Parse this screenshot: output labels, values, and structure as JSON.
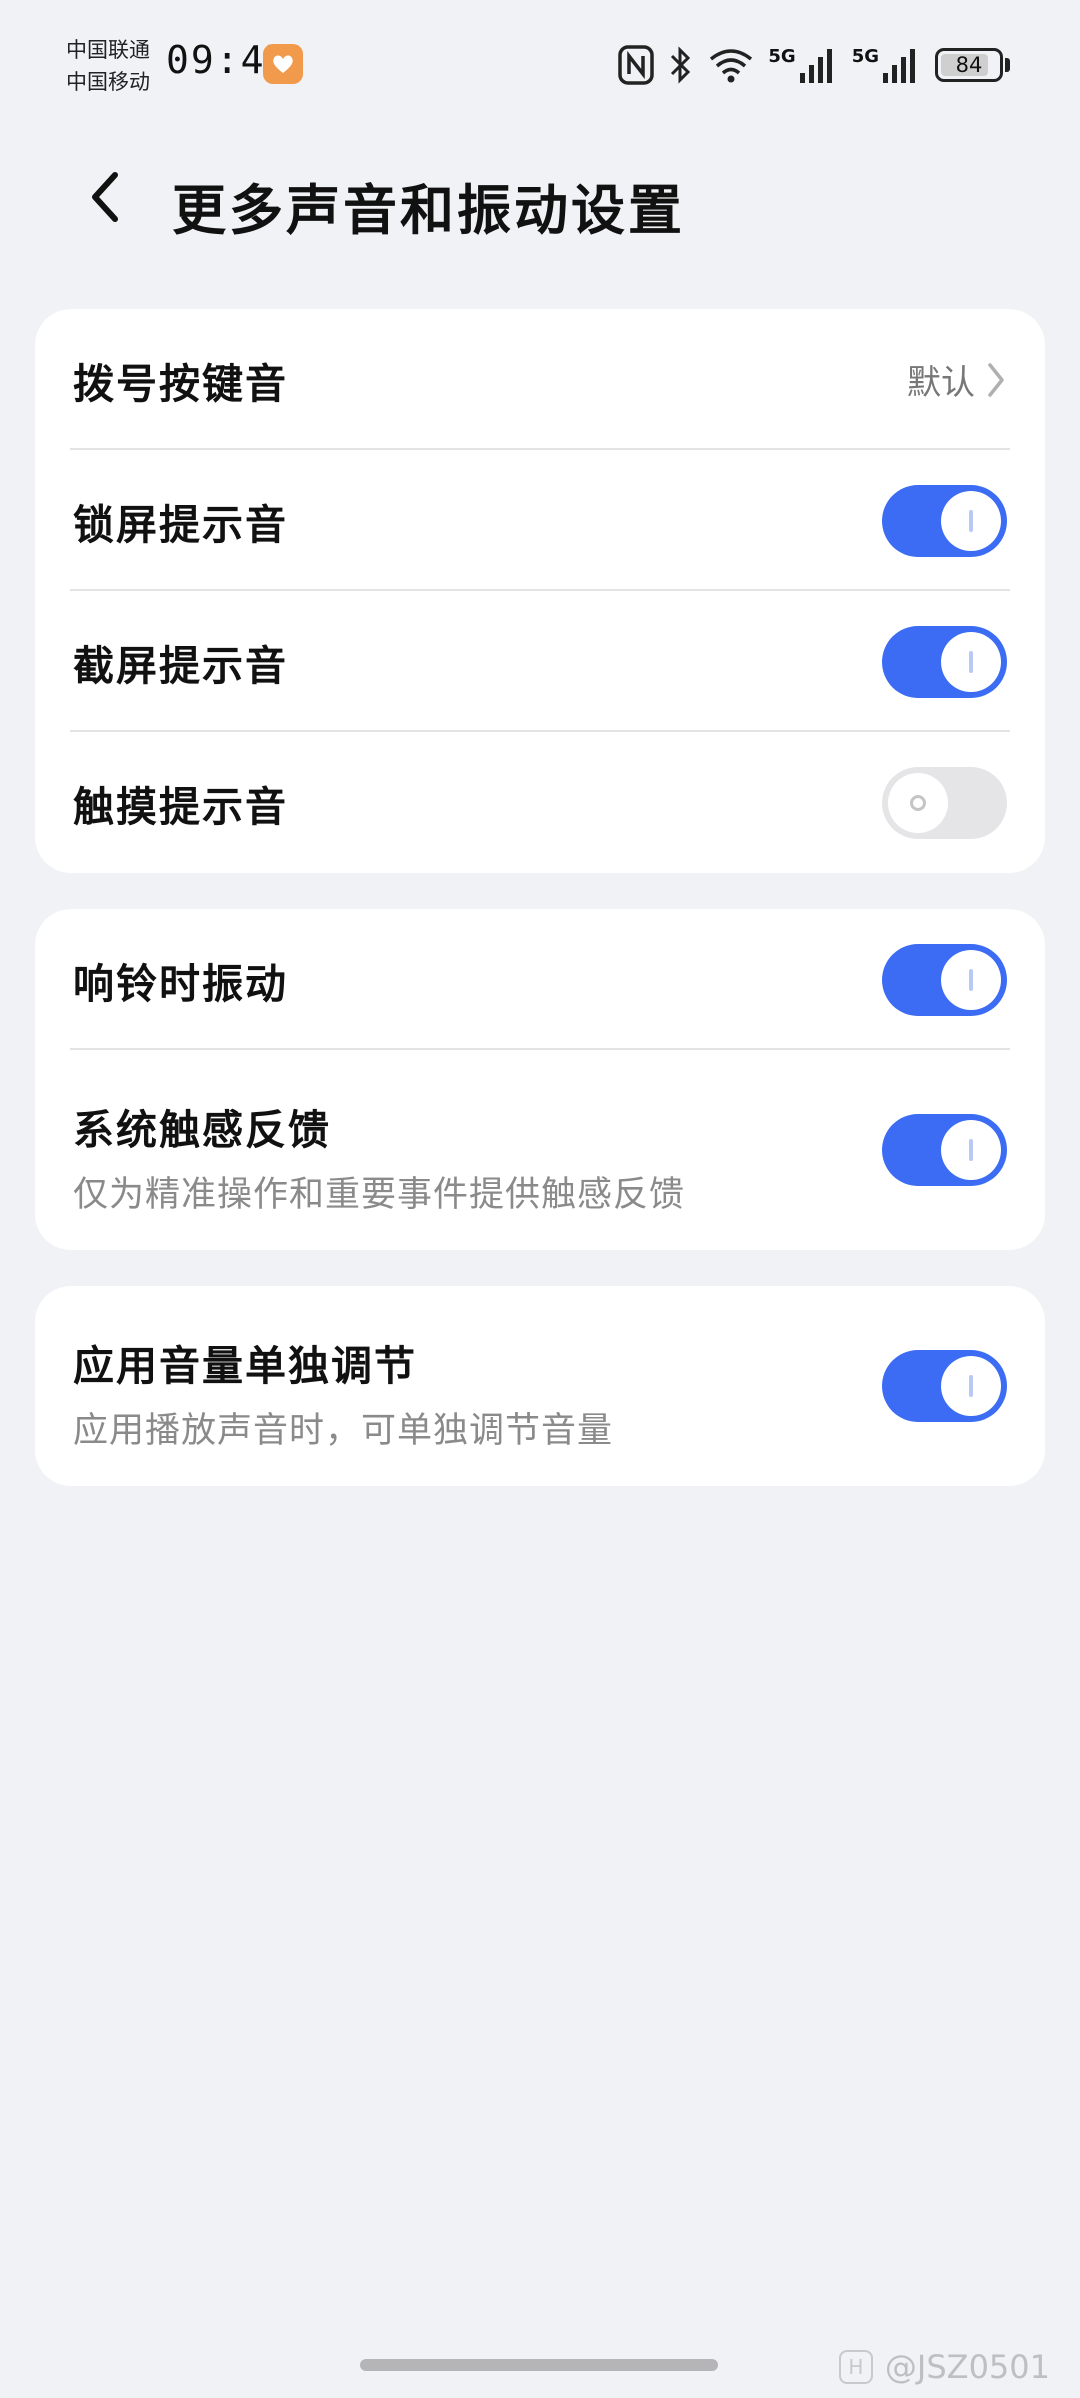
{
  "status_bar": {
    "carrier_1": "中国联通",
    "carrier_2": "中国移动",
    "time": "09:47",
    "network_1": "5G",
    "network_2": "5G",
    "battery": "84",
    "battery_level": 0.84
  },
  "header": {
    "title": "更多声音和振动设置"
  },
  "card1": {
    "dial_tone": {
      "label": "拨号按键音",
      "value": "默认"
    },
    "lock_sound": {
      "label": "锁屏提示音",
      "on": true
    },
    "screenshot_sound": {
      "label": "截屏提示音",
      "on": true
    },
    "touch_sound": {
      "label": "触摸提示音",
      "on": false
    }
  },
  "card2": {
    "ring_vibrate": {
      "label": "响铃时振动",
      "on": true
    },
    "haptic": {
      "label": "系统触感反馈",
      "sub": "仅为精准操作和重要事件提供触感反馈",
      "on": true
    }
  },
  "card3": {
    "app_volume": {
      "label": "应用音量单独调节",
      "sub": "应用播放声音时，可单独调节音量",
      "on": true
    }
  },
  "watermark": "@JSZ0501",
  "colors": {
    "accent": "#3b6cf3",
    "background": "#f1f2f6",
    "toggle_off": "#e5e5e7"
  }
}
